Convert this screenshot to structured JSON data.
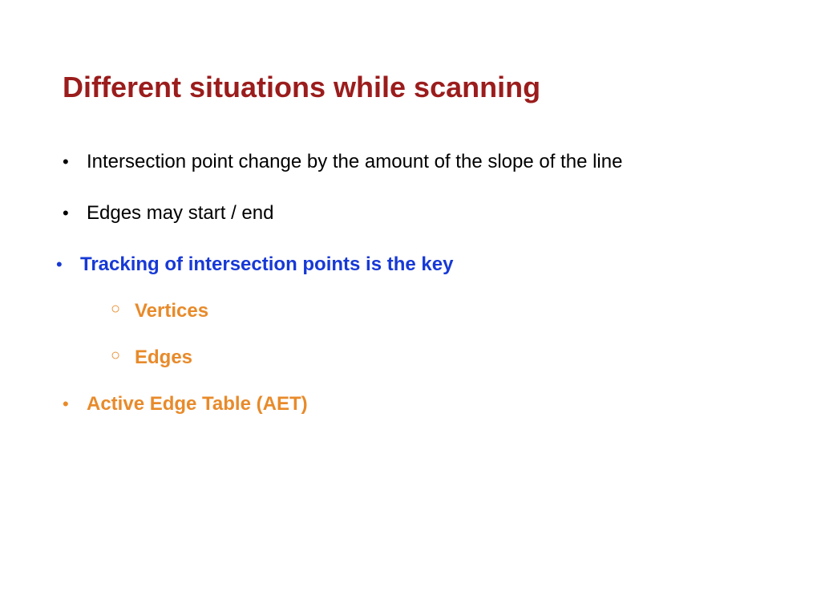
{
  "slide": {
    "title": "Different situations while scanning",
    "bullets": [
      {
        "text": "Intersection point change by the amount of the slope of the line",
        "style": "normal"
      },
      {
        "text": "Edges may start / end",
        "style": "normal"
      },
      {
        "text": "Tracking of intersection points is the key",
        "style": "blue",
        "sub": [
          "Vertices",
          "Edges"
        ]
      },
      {
        "text": "Active Edge Table (AET)",
        "style": "orange"
      }
    ]
  }
}
